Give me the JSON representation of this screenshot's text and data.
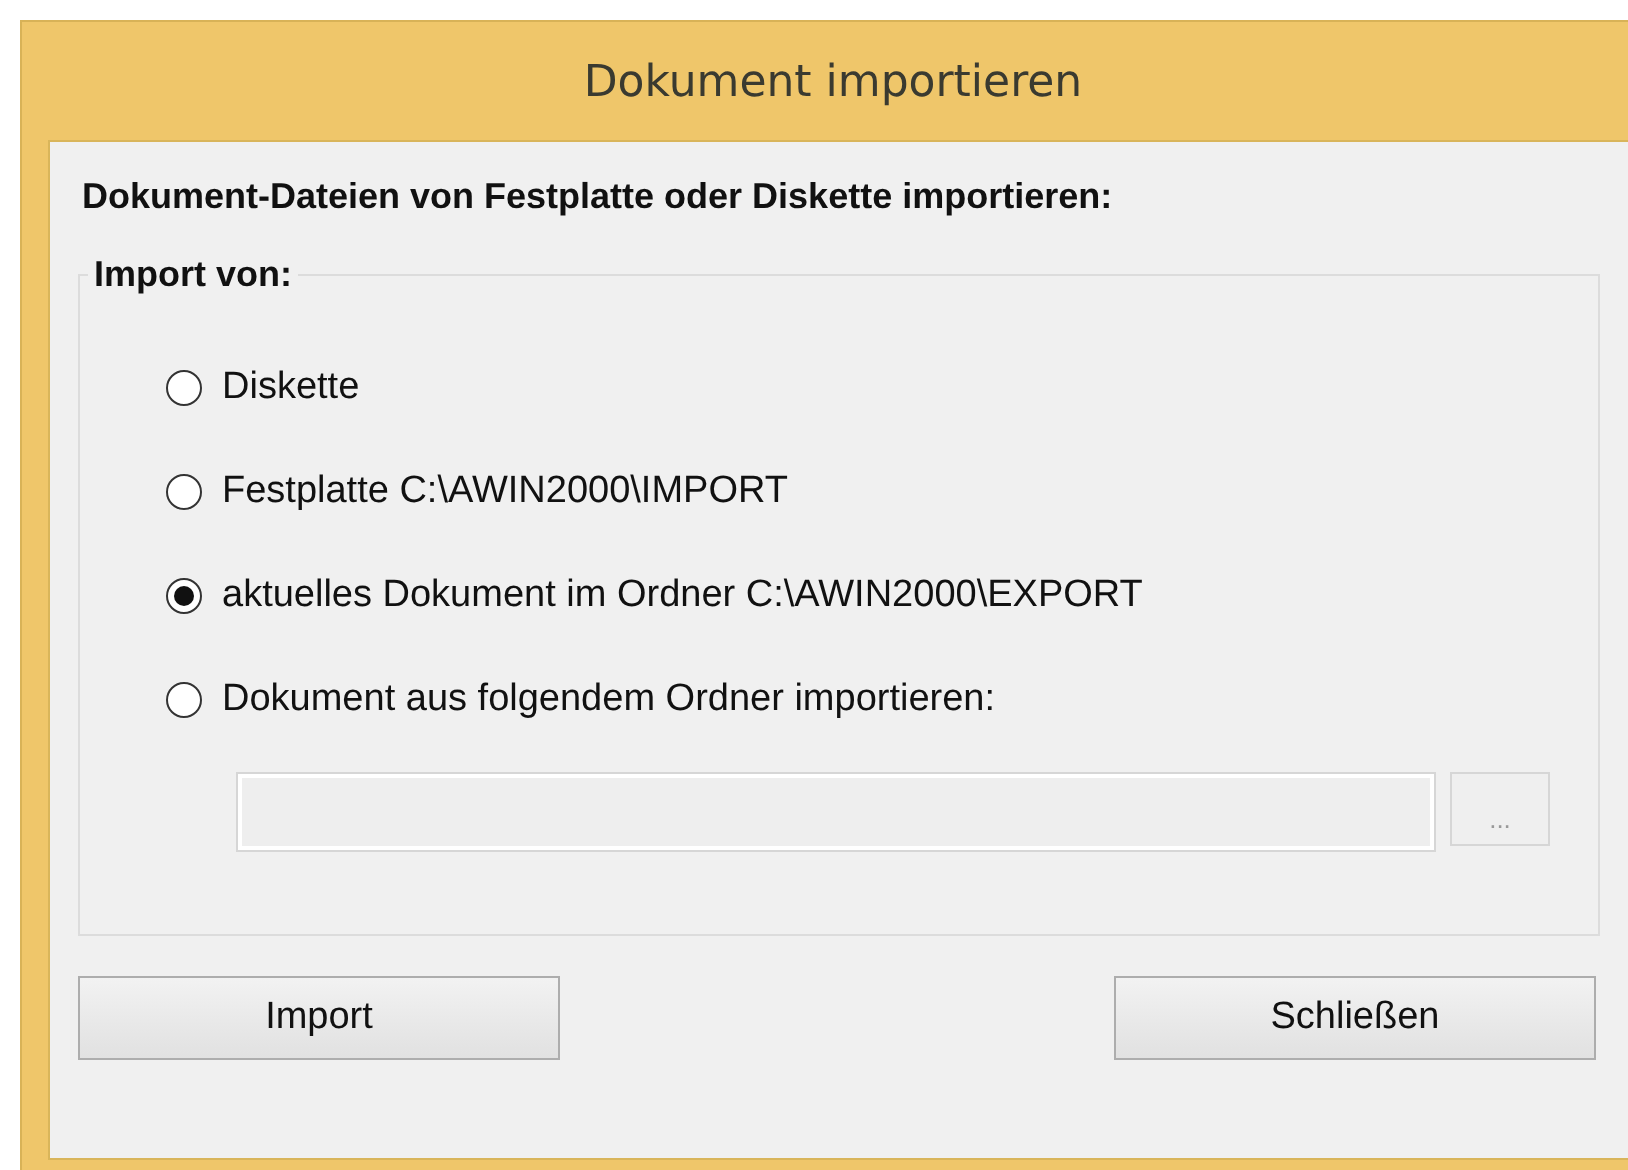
{
  "window": {
    "title": "Dokument importieren"
  },
  "heading": "Dokument-Dateien von Festplatte oder Diskette importieren:",
  "group": {
    "legend": "Import von:",
    "options": [
      {
        "label": "Diskette",
        "selected": false
      },
      {
        "label": "Festplatte C:\\AWIN2000\\IMPORT",
        "selected": false
      },
      {
        "label": "aktuelles Dokument im Ordner C:\\AWIN2000\\EXPORT",
        "selected": true
      },
      {
        "label": "Dokument aus folgendem Ordner importieren:",
        "selected": false
      }
    ],
    "folder_field": {
      "disabled": true
    },
    "browse_button": "..."
  },
  "buttons": [
    "Import",
    "Schließen"
  ]
}
